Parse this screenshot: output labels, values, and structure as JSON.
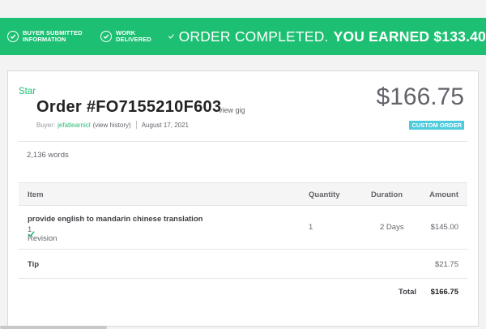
{
  "banner": {
    "step1_label": "Buyer submitted information",
    "step2_label": "Work delivered",
    "status_text": "ORDER COMPLETED.",
    "earned_text": "YOU EARNED $133.40",
    "color": "#1dbf73"
  },
  "order": {
    "tag": "Star",
    "title": "Order #FO7155210F603",
    "view_gig": "view gig",
    "buyer_prefix": "Buyer:",
    "buyer_name": "jefatlearnicl",
    "view_history": "(view history)",
    "date": "August 17, 2021",
    "price": "$166.75",
    "badge": "CUSTOM ORDER",
    "badge_color": "#4ecbdd"
  },
  "word_count": "2,136 words",
  "table": {
    "headers": {
      "item": "Item",
      "quantity": "Quantity",
      "duration": "Duration",
      "amount": "Amount"
    },
    "rows": [
      {
        "item": "provide english to mandarin chinese translation",
        "revision": "1 Revision",
        "quantity": "1",
        "duration": "2 Days",
        "amount": "$145.00"
      }
    ],
    "tip": {
      "label": "Tip",
      "amount": "$21.75"
    },
    "total": {
      "label": "Total",
      "amount": "$166.75"
    }
  }
}
